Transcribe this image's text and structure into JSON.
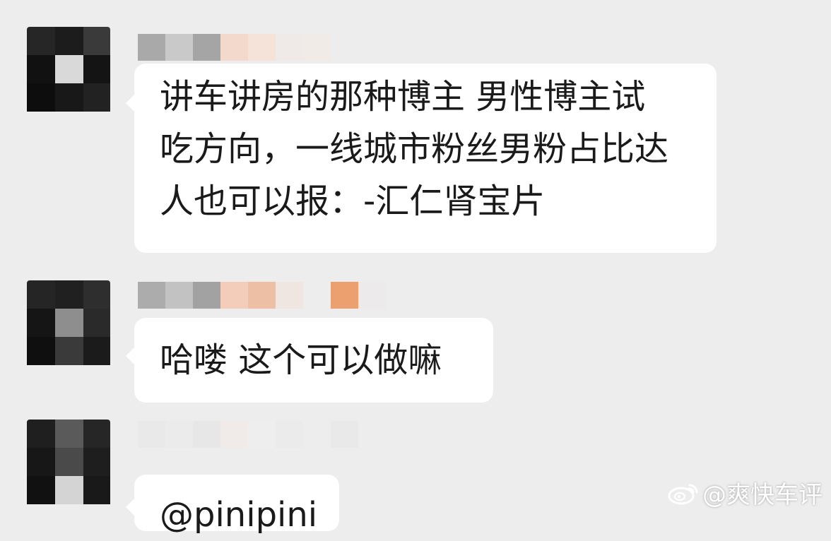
{
  "messages": [
    {
      "lines": [
        "讲车讲房的那种博主 男性博主试",
        "吃方向，一线城市粉丝男粉占比达",
        "人也可以报：-汇仁肾宝片"
      ]
    },
    {
      "lines": [
        "哈喽  这个可以做嘛"
      ]
    },
    {
      "lines": [
        "@pinipini"
      ]
    }
  ],
  "watermark": {
    "text": "@爽快车评",
    "icon": "weibo-icon"
  }
}
